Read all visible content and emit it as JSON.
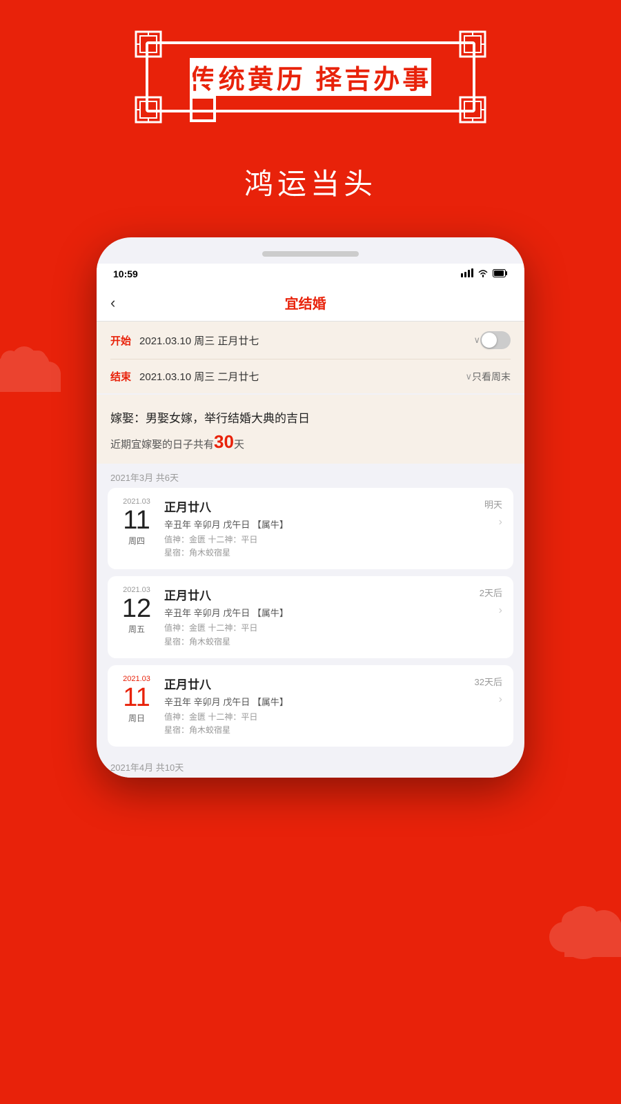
{
  "app": {
    "background_color": "#e8220a"
  },
  "banner": {
    "text": "传统黄历  择吉办事"
  },
  "subtitle": "鸿运当头",
  "phone": {
    "status_bar": {
      "time": "10:59",
      "signal": "▲▲▲",
      "wifi": "WiFi",
      "battery": "🔋"
    },
    "nav": {
      "back_icon": "‹",
      "title": "宜结婚"
    },
    "filter": {
      "start_label": "开始",
      "start_value": "2021.03.10 周三 正月廿七",
      "end_label": "结束",
      "end_value": "2021.03.10 周三 二月廿七",
      "weekend_label": "只看周末"
    },
    "info": {
      "title": "嫁娶：男娶女嫁，举行结婚大典的吉日",
      "count_prefix": "近期宜嫁娶的日子共有",
      "count": "30",
      "count_suffix": "天"
    },
    "month_header_1": "2021年3月  共6天",
    "cards": [
      {
        "year_month": "2021.03",
        "day": "11",
        "day_color": "normal",
        "weekday": "周四",
        "lunar": "正月廿八",
        "ganzhi": "辛丑年 辛卯月 戊午日 【属牛】",
        "detail1": "值神：金匮  十二神：平日",
        "detail2": "星宿：角木蛟宿星",
        "tag": "明天",
        "has_arrow": true
      },
      {
        "year_month": "2021.03",
        "day": "12",
        "day_color": "normal",
        "weekday": "周五",
        "lunar": "正月廿八",
        "ganzhi": "辛丑年 辛卯月 戊午日 【属牛】",
        "detail1": "值神：金匮  十二神：平日",
        "detail2": "星宿：角木蛟宿星",
        "tag": "2天后",
        "has_arrow": true
      },
      {
        "year_month": "2021.03",
        "day": "11",
        "day_color": "red",
        "weekday": "周日",
        "lunar": "正月廿八",
        "ganzhi": "辛丑年 辛卯月 戊午日 【属牛】",
        "detail1": "值神：金匮  十二神：平日",
        "detail2": "星宿：角木蛟宿星",
        "tag": "32天后",
        "has_arrow": true
      }
    ],
    "month_header_2": "2021年4月  共10天"
  }
}
